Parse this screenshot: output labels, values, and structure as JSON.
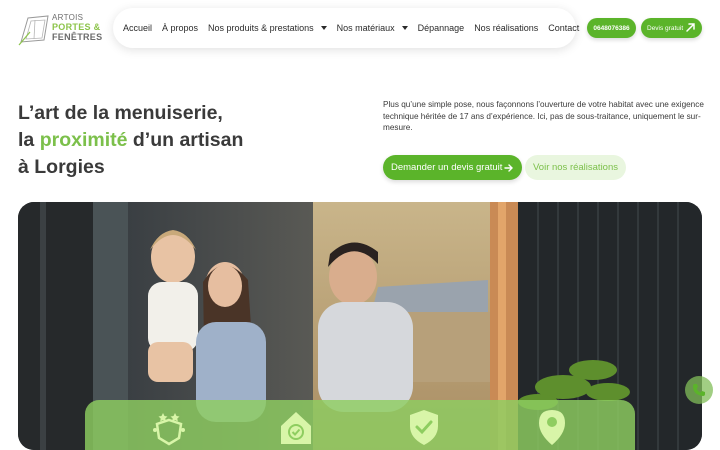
{
  "logo": {
    "line1": "ARTOIS",
    "line2": "PORTES &",
    "line3": "FENÊTRES"
  },
  "nav": {
    "items": [
      {
        "label": "Accueil",
        "has_dropdown": false
      },
      {
        "label": "À propos",
        "has_dropdown": false
      },
      {
        "label": "Nos produits & prestations",
        "has_dropdown": true
      },
      {
        "label": "Nos matériaux",
        "has_dropdown": true
      },
      {
        "label": "Dépannage",
        "has_dropdown": false
      },
      {
        "label": "Nos réalisations",
        "has_dropdown": false
      },
      {
        "label": "Contact",
        "has_dropdown": false
      }
    ]
  },
  "header_buttons": {
    "phone": "0648076386",
    "quote": "Devis gratuit"
  },
  "hero": {
    "headline_line1": "L’art de la menuiserie,",
    "headline_line2_pre": "la ",
    "headline_accent": "proximité",
    "headline_line2_post": " d’un artisan",
    "headline_line3": "à Lorgies",
    "intro": "Plus qu’une simple pose, nous façonnons l’ouverture de votre habitat avec une exigence technique héritée de 17 ans d’expérience. Ici, pas de sous-traitance, uniquement le sur-mesure.",
    "cta_primary": "Demander un devis gratuit",
    "cta_secondary": "Voir nos réalisations"
  },
  "features": {
    "icons": [
      "stars-badge-icon",
      "home-check-icon",
      "shield-check-icon",
      "location-pin-icon"
    ]
  },
  "colors": {
    "brand_green": "#5bb42a",
    "accent_green": "#7cc04b",
    "light_green": "#e9f6df",
    "text": "#3a3a3a"
  }
}
